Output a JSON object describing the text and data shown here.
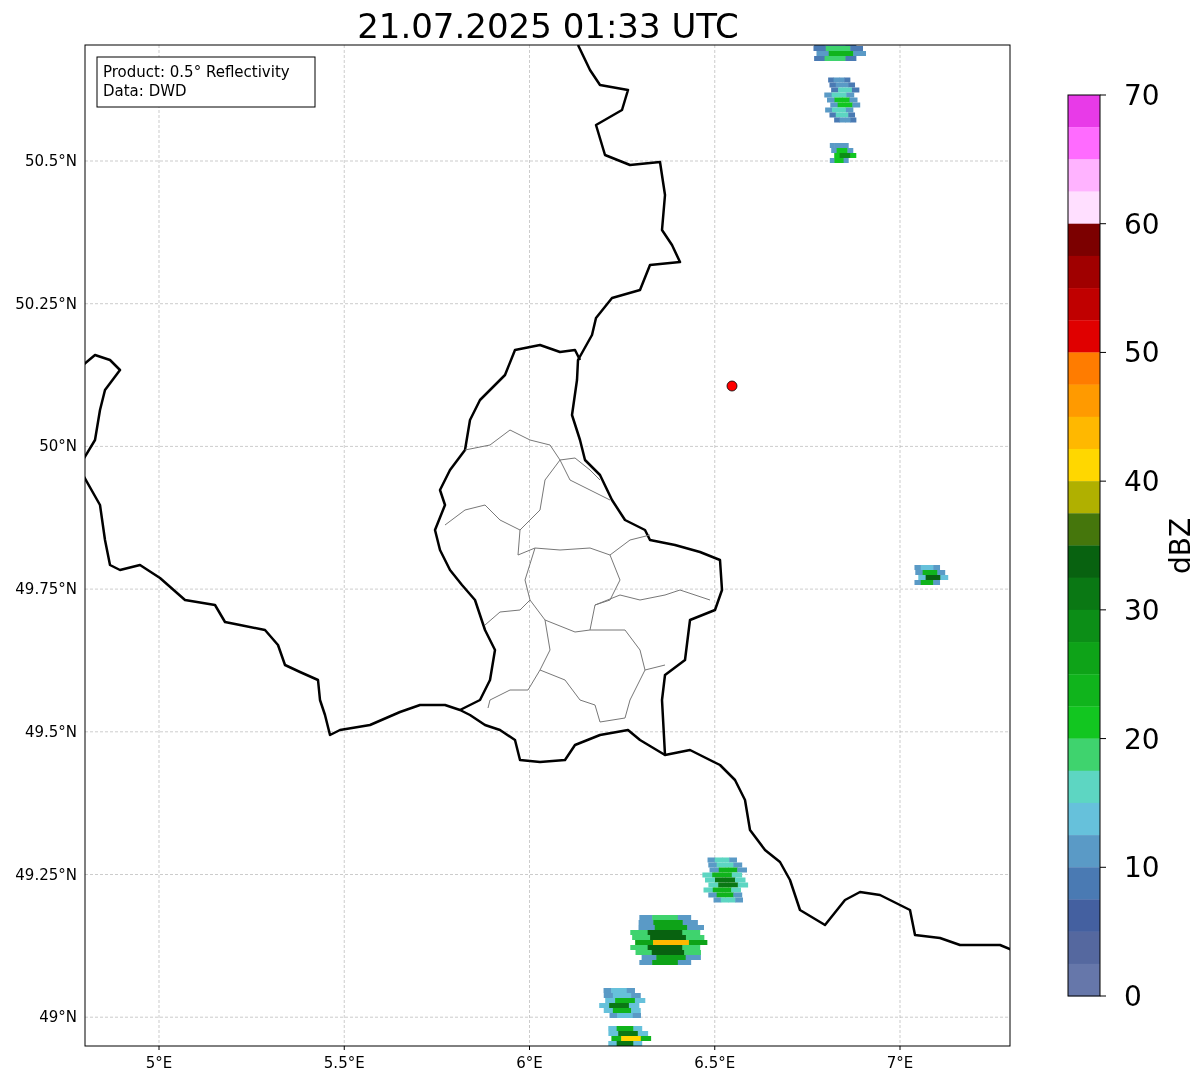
{
  "title": "21.07.2025 01:33 UTC",
  "info_box": [
    "Product: 0.5° Reflectivity",
    "Data: DWD"
  ],
  "map": {
    "lat_ticks": [
      "50.5°N",
      "50.25°N",
      "50°N",
      "49.75°N",
      "49.5°N",
      "49.25°N",
      "49°N"
    ],
    "lon_ticks": [
      "5°E",
      "5.5°E",
      "6°E",
      "6.5°E",
      "7°E"
    ]
  },
  "colorbar": {
    "label": "dBZ",
    "ticks": [
      "70",
      "60",
      "50",
      "40",
      "30",
      "20",
      "10",
      "0"
    ],
    "bins": [
      {
        "color": "#e83ae8"
      },
      {
        "color": "#ff6bff"
      },
      {
        "color": "#ffb3ff"
      },
      {
        "color": "#ffdfff"
      },
      {
        "color": "#7c0000"
      },
      {
        "color": "#a00000"
      },
      {
        "color": "#c00000"
      },
      {
        "color": "#e00000"
      },
      {
        "color": "#ff7c00"
      },
      {
        "color": "#ff9a00"
      },
      {
        "color": "#ffb800"
      },
      {
        "color": "#ffd700"
      },
      {
        "color": "#b0b000"
      },
      {
        "color": "#45760c"
      },
      {
        "color": "#086210"
      },
      {
        "color": "#0a7814"
      },
      {
        "color": "#0c8e17"
      },
      {
        "color": "#0ea318"
      },
      {
        "color": "#10b41c"
      },
      {
        "color": "#12c620"
      },
      {
        "color": "#3fd36e"
      },
      {
        "color": "#5dd6c2"
      },
      {
        "color": "#66c1db"
      },
      {
        "color": "#5a9ac6"
      },
      {
        "color": "#4a7ab3"
      },
      {
        "color": "#4460a0"
      },
      {
        "color": "#55689f"
      },
      {
        "color": "#6677aa"
      }
    ]
  }
}
